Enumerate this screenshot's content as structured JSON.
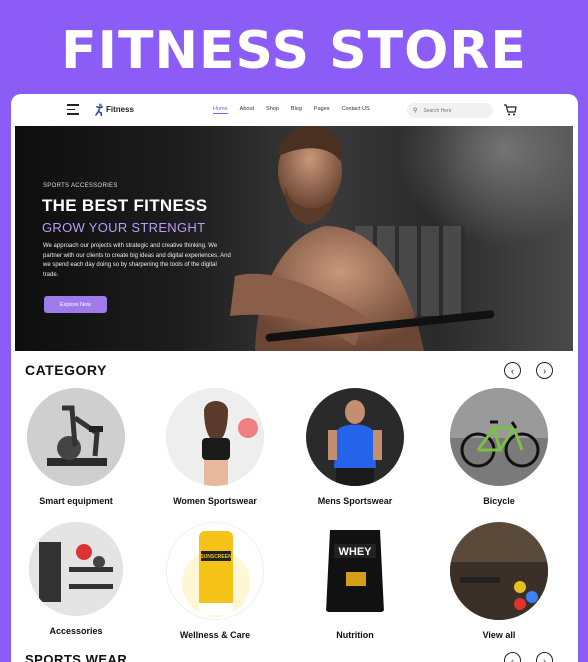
{
  "banner": {
    "title": "FITNESS STORE"
  },
  "nav": {
    "logo": "Fitness",
    "menu": [
      "Home",
      "About",
      "Shop",
      "Blog",
      "Pages",
      "Contact US"
    ],
    "search_placeholder": "Search Here"
  },
  "hero": {
    "kicker": "SPORTS ACCESSORIES",
    "title": "THE BEST FITNESS",
    "subtitle": "GROW YOUR STRENGHT",
    "body": "We approach our projects with strategic and creative thinking. We partner with our clients to create big ideas and digital experiences. And we spend each day doing so by sharpening the tools of the digital trade.",
    "button": "Explore Now"
  },
  "category": {
    "title": "CATEGORY",
    "prev": "‹",
    "next": "›",
    "items": [
      "Smart equipment",
      "Women Sportswear",
      "Mens Sportswear",
      "Bicycle",
      "Accessories",
      "Wellness & Care",
      "Nutrition",
      "View all"
    ]
  },
  "sportswear": {
    "title": "SPORTS WEAR"
  },
  "colors": {
    "brand": "#8B5CF6",
    "accent_light": "#B79CFA",
    "button": "#9F7AEA"
  }
}
